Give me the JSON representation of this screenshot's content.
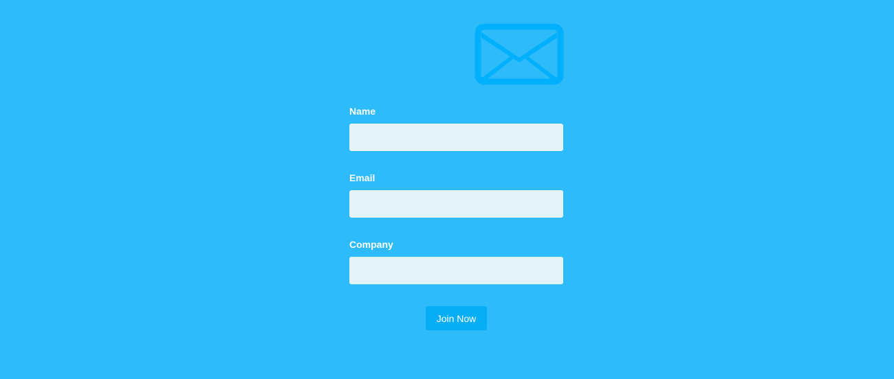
{
  "icon": {
    "name": "envelope-icon",
    "color": "#00b0fc"
  },
  "form": {
    "fields": [
      {
        "label": "Name",
        "value": "",
        "placeholder": ""
      },
      {
        "label": "Email",
        "value": "",
        "placeholder": ""
      },
      {
        "label": "Company",
        "value": "",
        "placeholder": ""
      }
    ],
    "submit_label": "Join Now"
  },
  "colors": {
    "background": "#2ebbf9",
    "input_background": "#e3f3f7",
    "button_background": "#07aef6",
    "text": "#ffffff"
  }
}
